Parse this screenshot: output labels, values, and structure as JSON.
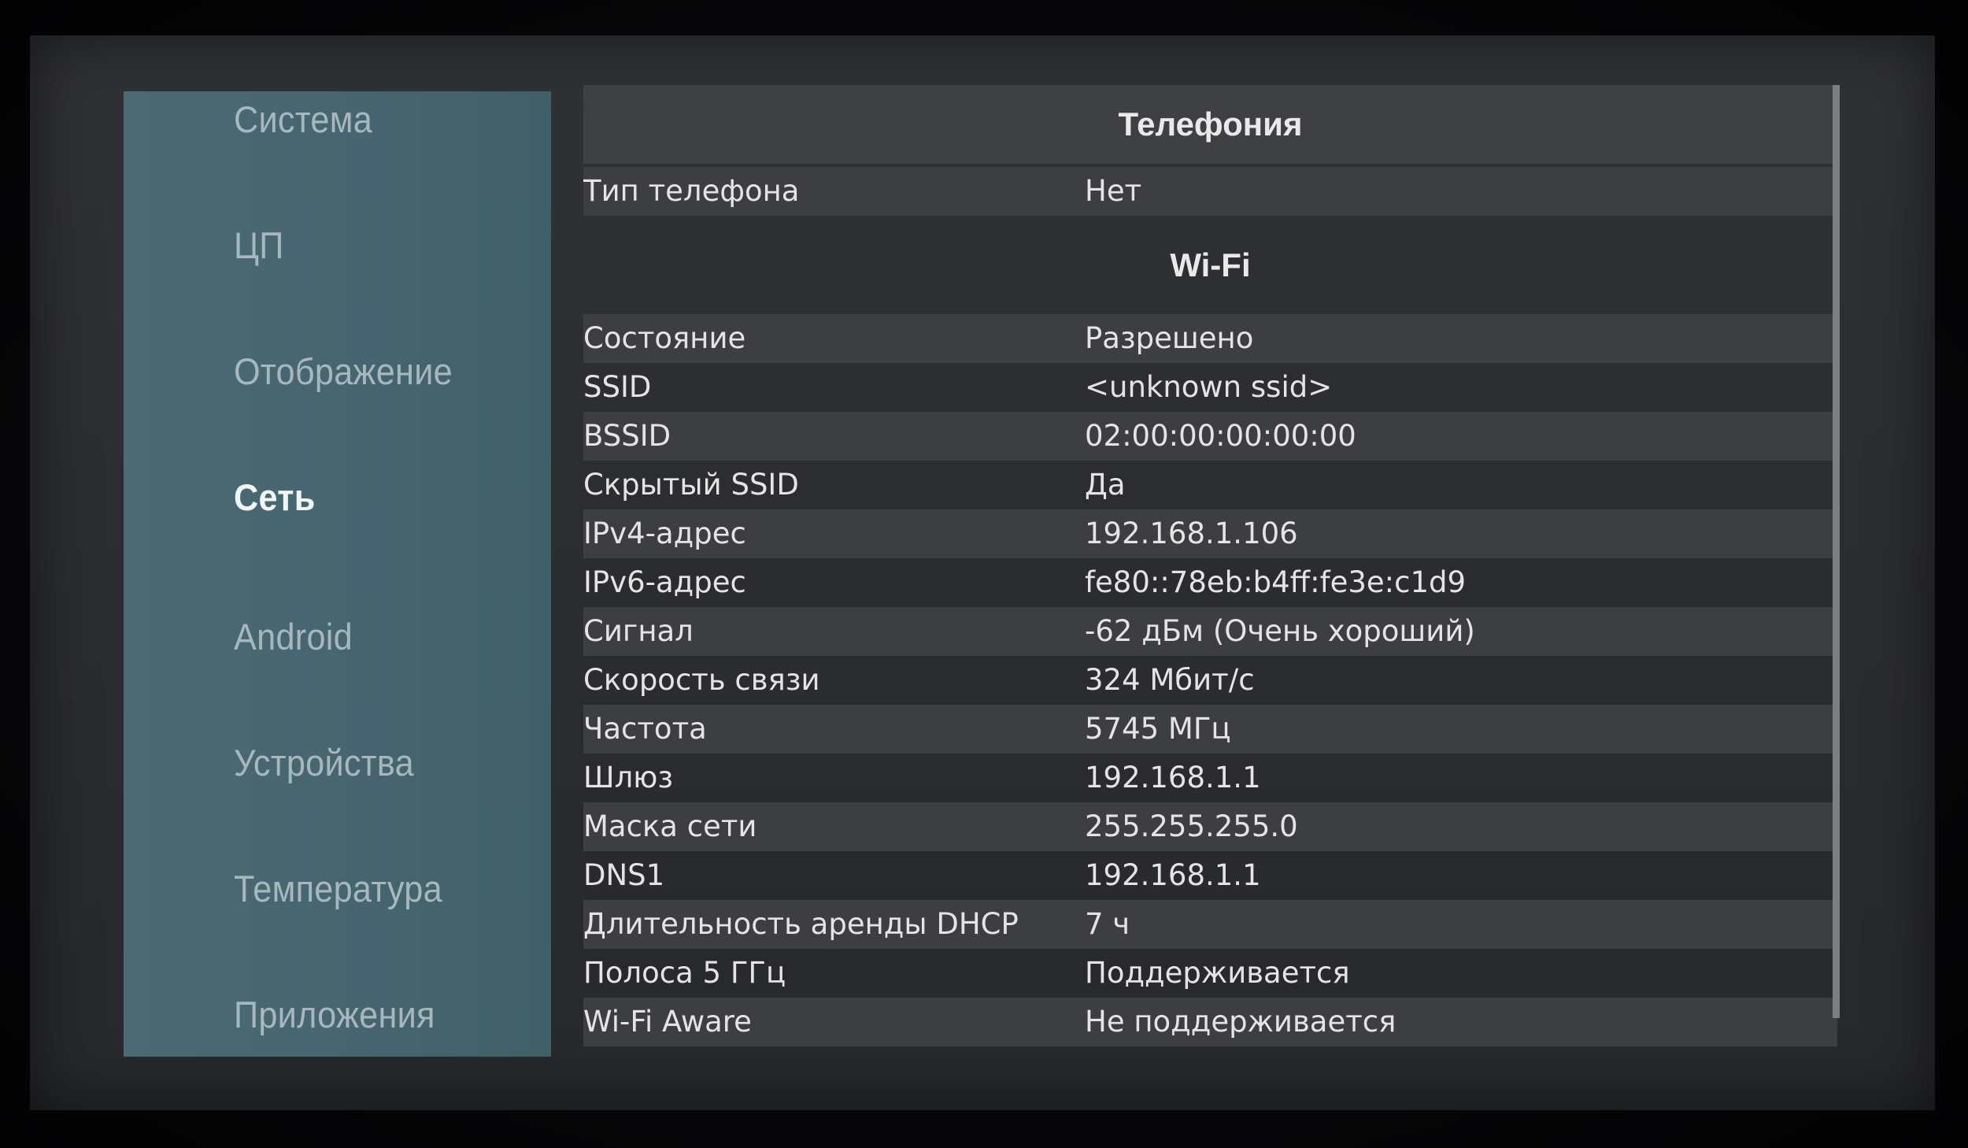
{
  "sidebar": {
    "items": [
      {
        "label": "Система",
        "active": false
      },
      {
        "label": "ЦП",
        "active": false
      },
      {
        "label": "Отображение",
        "active": false
      },
      {
        "label": "Сеть",
        "active": true
      },
      {
        "label": "Android",
        "active": false
      },
      {
        "label": "Устройства",
        "active": false
      },
      {
        "label": "Температура",
        "active": false
      },
      {
        "label": "Приложения",
        "active": false
      }
    ]
  },
  "telephony": {
    "title": "Телефония",
    "rows": [
      {
        "label": "Тип телефона",
        "value": "Нет"
      }
    ]
  },
  "wifi": {
    "title": "Wi-Fi",
    "rows": [
      {
        "label": "Состояние",
        "value": "Разрешено"
      },
      {
        "label": "SSID",
        "value": "<unknown ssid>"
      },
      {
        "label": "BSSID",
        "value": "02:00:00:00:00:00"
      },
      {
        "label": "Скрытый SSID",
        "value": "Да"
      },
      {
        "label": "IPv4-адрес",
        "value": "192.168.1.106"
      },
      {
        "label": "IPv6-адрес",
        "value": "fe80::78eb:b4ff:fe3e:c1d9"
      },
      {
        "label": "Сигнал",
        "value": "-62 дБм (Очень хороший)"
      },
      {
        "label": "Скорость связи",
        "value": "324 Мбит/с"
      },
      {
        "label": "Частота",
        "value": "5745 МГц"
      },
      {
        "label": "Шлюз",
        "value": "192.168.1.1"
      },
      {
        "label": "Маска сети",
        "value": "255.255.255.0"
      },
      {
        "label": "DNS1",
        "value": "192.168.1.1"
      },
      {
        "label": "Длительность аренды DHCP",
        "value": "7 ч"
      },
      {
        "label": "Полоса 5 ГГц",
        "value": "Поддерживается"
      },
      {
        "label": "Wi-Fi Aware",
        "value": "Не поддерживается"
      }
    ]
  },
  "colors": {
    "sidebar_bg": "#476570",
    "panel_bg": "#2c2e32",
    "stripe_bg": "#3d3e42",
    "active_text": "#f2f5f6",
    "inactive_text": "#a6b8bd"
  }
}
